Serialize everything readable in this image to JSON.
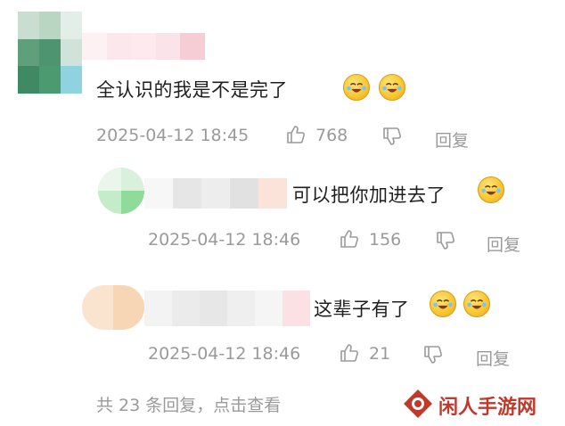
{
  "comments": [
    {
      "text": "全认识的我是不是完了",
      "time": "2025-04-12 18:45",
      "likes": "768",
      "reply_label": "回复",
      "emojis": [
        "laugh-cry-emoji",
        "laugh-cry-emoji"
      ]
    },
    {
      "text": "可以把你加进去了",
      "time": "2025-04-12 18:46",
      "likes": "156",
      "reply_label": "回复",
      "emojis": [
        "laugh-cry-emoji"
      ]
    },
    {
      "text": "这辈子有了",
      "time": "2025-04-12 18:46",
      "likes": "21",
      "reply_label": "回复",
      "emojis": [
        "laugh-cry-emoji",
        "laugh-cry-emoji"
      ]
    }
  ],
  "footer": {
    "replies_summary": "共 23 条回复，点击查看"
  },
  "watermark": {
    "text": "闲人手游网",
    "icon": "diamond-logo-icon"
  },
  "colors": {
    "meta_text": "#9a9a9a",
    "body_text": "#1f1f1f",
    "watermark": "#c0392b"
  }
}
